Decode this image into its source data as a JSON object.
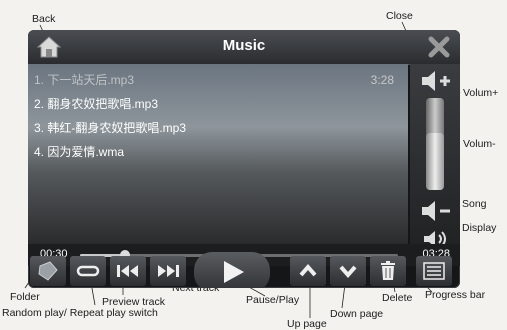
{
  "callouts": {
    "back": "Back",
    "close": "Close",
    "volume_up": "Volum+",
    "volume_down": "Volum-",
    "song": "Song",
    "display": "Display",
    "folder": "Folder",
    "random_repeat": "Random play/ Repeat play switch",
    "preview_track": "Preview track",
    "next_track": "Next track",
    "pause_play": "Pause/Play",
    "up_page": "Up page",
    "down_page": "Down page",
    "delete": "Delete",
    "progress_bar": "Progress bar"
  },
  "app": {
    "title": "Music"
  },
  "playlist": [
    {
      "label": "1. 下一站天后.mp3",
      "duration": "3:28"
    },
    {
      "label": "2. 翻身农奴把歌唱.mp3",
      "duration": ""
    },
    {
      "label": "3. 韩红-翻身农奴把歌唱.mp3",
      "duration": ""
    },
    {
      "label": "4. 因为爱情.wma",
      "duration": ""
    }
  ],
  "progress": {
    "elapsed": "00:30",
    "total": "03:28",
    "fraction": 0.14
  },
  "volume": {
    "level": 0.62
  },
  "icons": {
    "back": "home-icon",
    "close": "close-icon",
    "volume_up": "volume-up-icon",
    "volume_down": "volume-down-icon",
    "song_display": "speaker-icon",
    "folder": "folder-icon",
    "repeat": "repeat-icon",
    "prev": "previous-track-icon",
    "next": "next-track-icon",
    "play": "play-icon",
    "up": "chevron-up-icon",
    "down": "chevron-down-icon",
    "delete": "trash-icon",
    "progress_bar": "list-icon"
  },
  "colors": {
    "screen_bg": "#151618",
    "text": "#ffffff"
  }
}
